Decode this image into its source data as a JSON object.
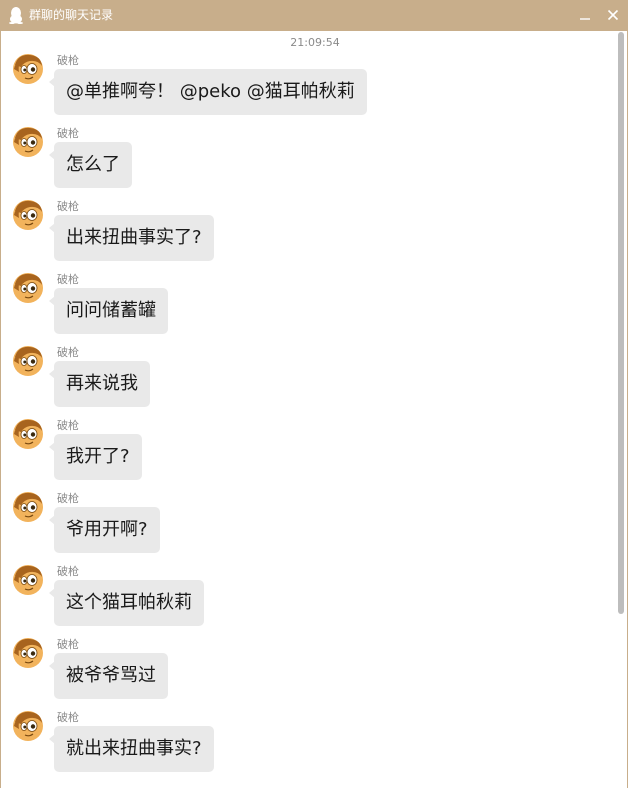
{
  "window": {
    "title": "群聊的聊天记录",
    "icon": "qq-penguin-icon",
    "minimize_label": "minimize",
    "close_label": "close"
  },
  "chat": {
    "timestamp": "21:09:54",
    "messages": [
      {
        "sender": "破枪",
        "text": "@单推啊夸！ @peko @猫耳帕秋莉"
      },
      {
        "sender": "破枪",
        "text": "怎么了"
      },
      {
        "sender": "破枪",
        "text": "出来扭曲事实了?"
      },
      {
        "sender": "破枪",
        "text": "问问储蓄罐"
      },
      {
        "sender": "破枪",
        "text": "再来说我"
      },
      {
        "sender": "破枪",
        "text": "我开了?"
      },
      {
        "sender": "破枪",
        "text": "爷用开啊?"
      },
      {
        "sender": "破枪",
        "text": "这个猫耳帕秋莉"
      },
      {
        "sender": "破枪",
        "text": "被爷爷骂过"
      },
      {
        "sender": "破枪",
        "text": "就出来扭曲事实?"
      }
    ]
  },
  "colors": {
    "titlebar": "#c8ae8b",
    "bubble": "#e9e9e9",
    "meta_text": "#8a8a8a",
    "scroll_thumb": "#bdbdbd"
  }
}
